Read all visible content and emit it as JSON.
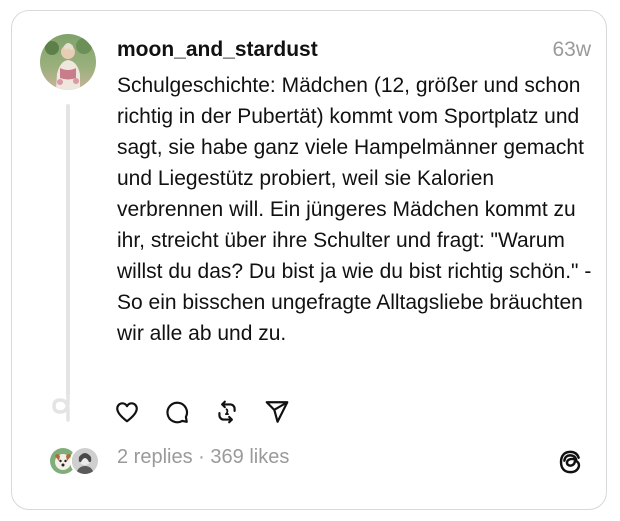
{
  "post": {
    "username": "moon_and_stardust",
    "timestamp": "63w",
    "text": "Schulgeschichte: Mädchen (12, größer und schon richtig in der Pubertät) kommt vom Sportplatz und sagt, sie habe ganz viele Hampelmänner gemacht und Liegestütz probiert, weil sie Kalorien verbrennen will. Ein jüngeres Mädchen kommt zu ihr, streicht über ihre Schulter und fragt: \"Warum willst du das? Du bist ja wie du bist richtig schön.\" - So ein bisschen ungefragte Alltagsliebe bräuchten wir alle ab und zu."
  },
  "actions": {
    "like_icon": "heart-icon",
    "comment_icon": "comment-icon",
    "repost_icon": "repost-icon",
    "share_icon": "send-icon"
  },
  "footer": {
    "replies": "2 replies",
    "separator": "·",
    "likes": "369 likes",
    "logo_icon": "threads-logo-icon"
  },
  "colors": {
    "text": "#111111",
    "muted": "#9a9a9a",
    "border": "#d9d9d9",
    "thread_line": "#e4e4e4"
  }
}
